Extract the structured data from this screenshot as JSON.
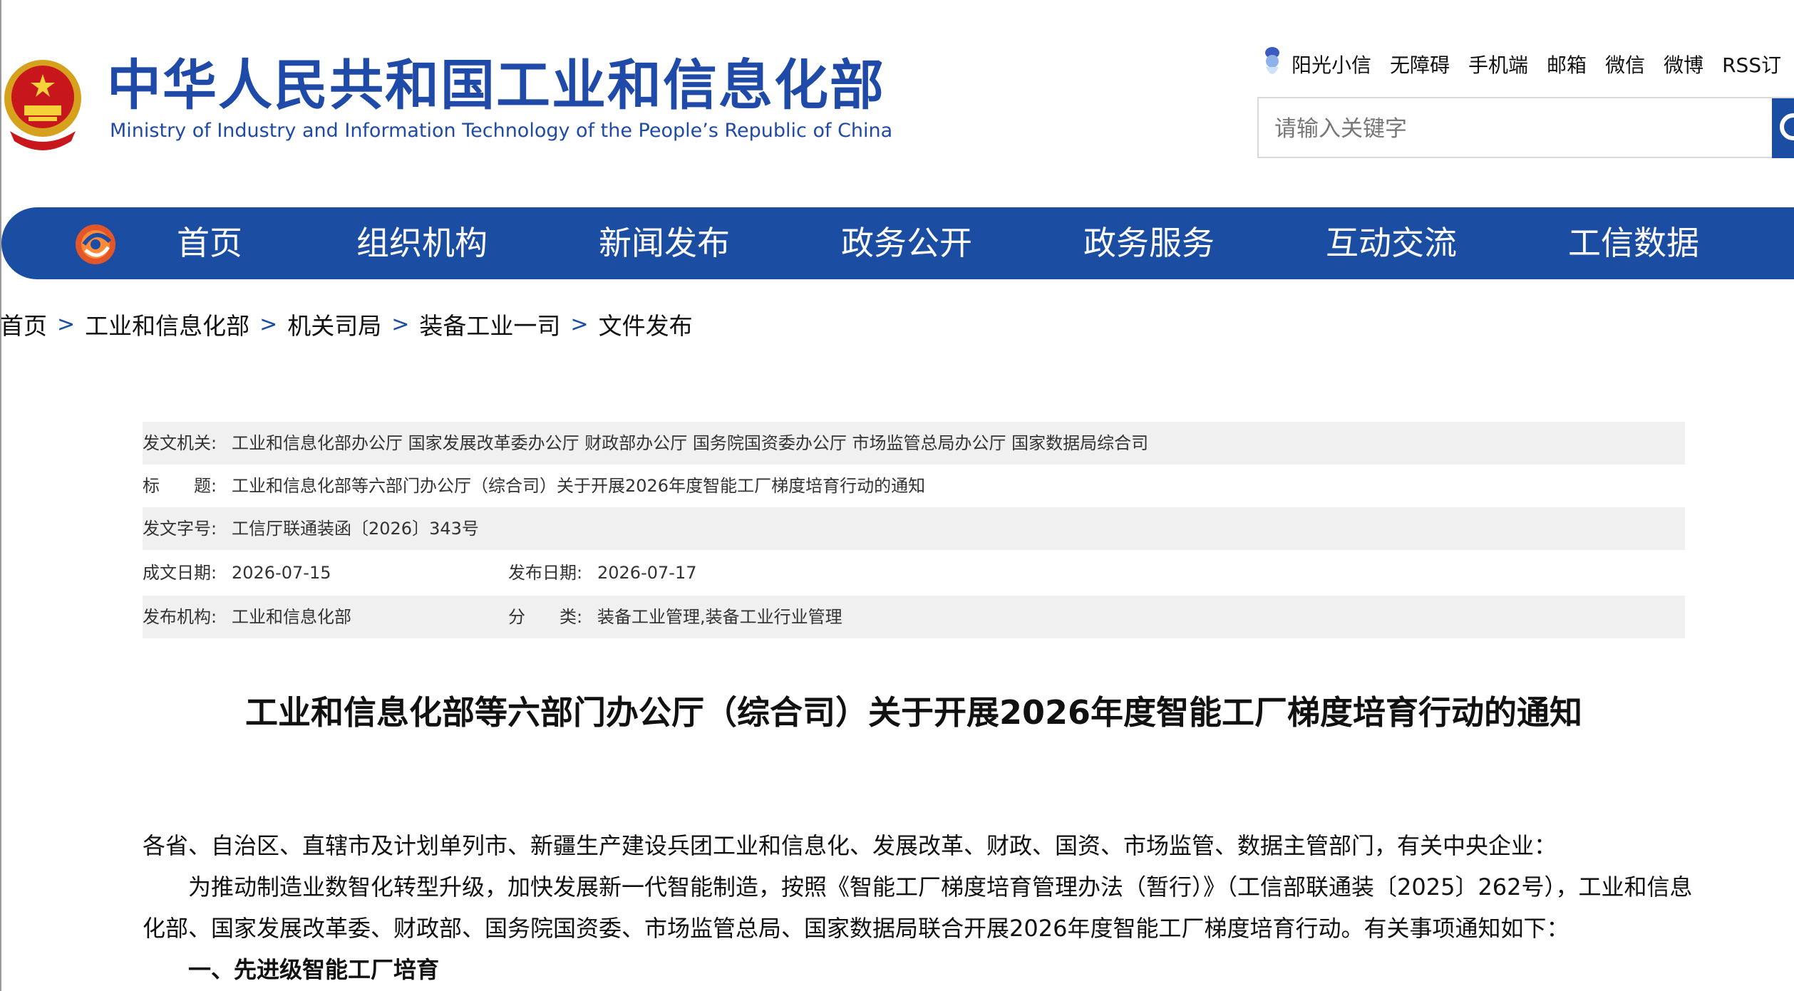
{
  "header": {
    "title_cn": "中华人民共和国工业和信息化部",
    "title_en": "Ministry of Industry and Information Technology of the People’s Republic of China",
    "links": [
      "阳光小信",
      "无障碍",
      "手机端",
      "邮箱",
      "微信",
      "微博",
      "RSS订"
    ],
    "search_placeholder": "请输入关键字"
  },
  "nav": {
    "items": [
      "首页",
      "组织机构",
      "新闻发布",
      "政务公开",
      "政务服务",
      "互动交流",
      "工信数据"
    ]
  },
  "breadcrumb": [
    "首页",
    "工业和信息化部",
    "机关司局",
    "装备工业一司",
    "文件发布"
  ],
  "breadcrumb_separator": ">",
  "meta": {
    "issuer_label": "发文机关:",
    "issuer": "工业和信息化部办公厅 国家发展改革委办公厅 财政部办公厅 国务院国资委办公厅 市场监管总局办公厅 国家数据局综合司",
    "title_label": "标　　题:",
    "title": "工业和信息化部等六部门办公厅（综合司）关于开展2026年度智能工厂梯度培育行动的通知",
    "docno_label": "发文字号:",
    "docno": "工信厅联通装函〔2026〕343号",
    "written_label": "成文日期:",
    "written": "2026-07-15",
    "published_label": "发布日期:",
    "published": "2026-07-17",
    "org_label": "发布机构:",
    "org": "工业和信息化部",
    "category_label": "分　　类:",
    "category": "装备工业管理,装备工业行业管理"
  },
  "document": {
    "title": "工业和信息化部等六部门办公厅（综合司）关于开展2026年度智能工厂梯度培育行动的通知",
    "addressee": "各省、自治区、直辖市及计划单列市、新疆生产建设兵团工业和信息化、发展改革、财政、国资、市场监管、数据主管部门，有关中央企业：",
    "para1_line1": "为推动制造业数智化转型升级，加快发展新一代智能制造，按照《智能工厂梯度培育管理办法（暂行）》（工信部联通装〔2025〕262号），工业和信息",
    "para1_line2": "化部、国家发展改革委、财政部、国务院国资委、市场监管总局、国家数据局联合开展2026年度智能工厂梯度培育行动。有关事项通知如下：",
    "section1": "一、先进级智能工厂培育"
  },
  "colors": {
    "brand_blue": "#1b4ea3",
    "title_blue": "#1f4aa8",
    "meta_grey": "#f0f0f0"
  },
  "icons": [
    "national-emblem-icon",
    "sunshine-mascot-icon",
    "search-icon",
    "gear-logo-icon"
  ]
}
